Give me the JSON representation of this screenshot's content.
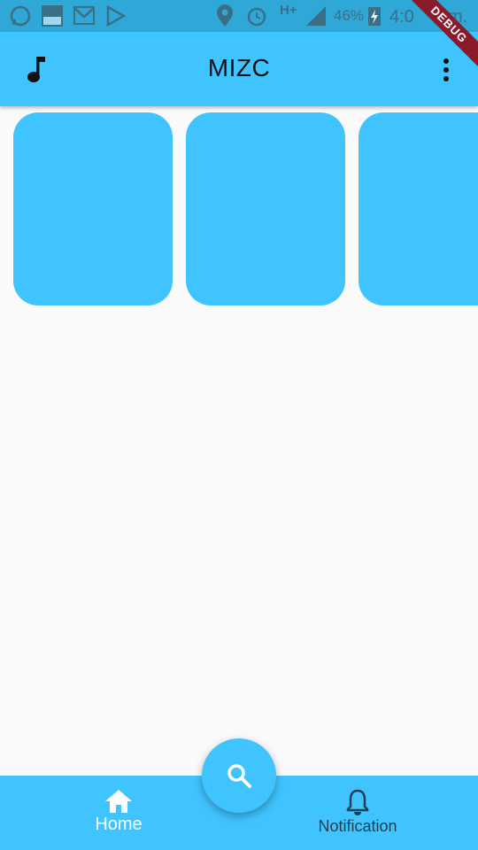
{
  "status_bar": {
    "battery": "46%",
    "time": "4:0",
    "time_suffix": "m.",
    "network": "H+"
  },
  "app_bar": {
    "title": "MIZC",
    "leading_icon": "music-note-icon",
    "trailing_icon": "more-vert-icon",
    "debug_banner": "DEBUG"
  },
  "cards": [
    {
      "color": "#40c4ff"
    },
    {
      "color": "#40c4ff"
    },
    {
      "color": "#40c4ff"
    }
  ],
  "bottom_nav": {
    "items": [
      {
        "label": "Home",
        "icon": "home-icon"
      },
      {
        "label": "Notification",
        "icon": "bell-icon"
      }
    ]
  },
  "fab": {
    "icon": "search-icon"
  },
  "colors": {
    "accent": "#40c4ff",
    "status_bar": "#2fa8d8",
    "background": "#fafafa"
  }
}
